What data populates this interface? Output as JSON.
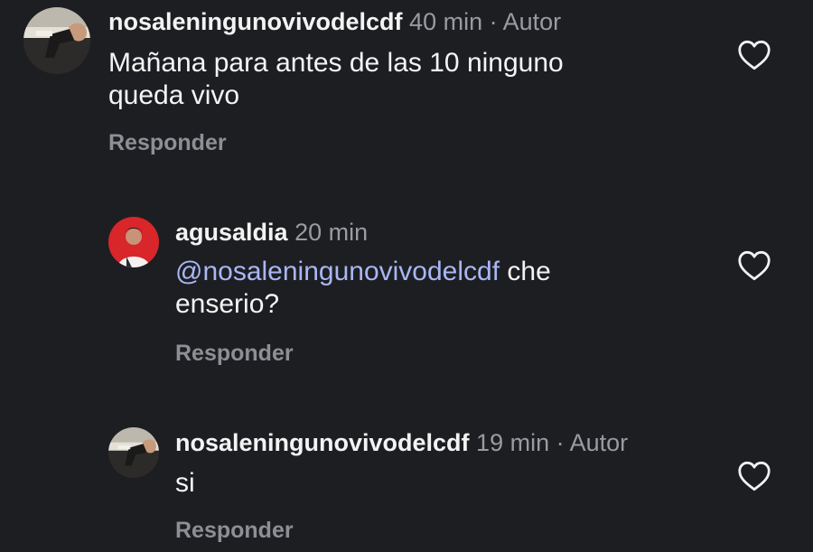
{
  "comments": [
    {
      "username": "nosaleningunovivodelcdf",
      "time": "40 min",
      "separator": "·",
      "author_tag": "Autor",
      "text_line1": "Mañana para antes de las 10 ninguno",
      "text_line2": "queda vivo",
      "reply_label": "Responder",
      "avatar_icon": "gun-hand-avatar",
      "like_icon": "heart-outline-icon"
    },
    {
      "username": "agusaldia",
      "time": "20 min",
      "mention": "@nosaleningunovivodelcdf",
      "text_after_mention": " che",
      "text_line2": "enserio?",
      "reply_label": "Responder",
      "avatar_icon": "person-red-background-avatar",
      "like_icon": "heart-outline-icon"
    },
    {
      "username": "nosaleningunovivodelcdf",
      "time": "19 min",
      "separator": "·",
      "author_tag": "Autor",
      "text_line1": "si",
      "reply_label": "Responder",
      "avatar_icon": "gun-hand-avatar",
      "like_icon": "heart-outline-icon"
    }
  ],
  "colors": {
    "background": "#1d1e22",
    "username": "#f3f3f3",
    "meta": "#9a9ba0",
    "mention": "#a9b7f3",
    "reply": "#8e8f94",
    "avatar_red": "#d8262a"
  }
}
